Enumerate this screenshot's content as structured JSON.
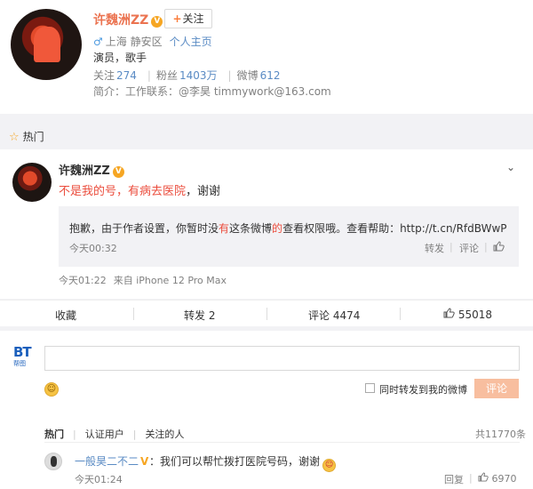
{
  "profile": {
    "name": "许魏洲ZZ",
    "verified_badge": "V",
    "follow_plus": "+",
    "follow_label": "关注",
    "location": "上海 静安区",
    "homepage_link": "个人主页",
    "intro": "演员，歌手",
    "stats": {
      "following_label": "关注",
      "following": "274",
      "fans_label": "粉丝",
      "fans": "1403万",
      "weibo_label": "微博",
      "weibo": "612"
    },
    "description": "简介：工作联系：@李昊 timmywork@163.com"
  },
  "hot_label": "热门",
  "post": {
    "author": "许魏洲ZZ",
    "text_red": "不是我的号，有病去医院",
    "text_plain": "，谢谢",
    "quote": {
      "text_a": "抱歉，由于作者设置，你暂时没",
      "text_red1": "有",
      "text_b": "这条微博",
      "text_red2": "的",
      "text_c": "查看权限哦。查看帮助：http://t.cn/RfdBWwP",
      "time": "今天00:32",
      "repost": "转发",
      "comment": "评论"
    },
    "time": "今天01:22",
    "source": "来自 iPhone 12 Pro Max"
  },
  "actions": {
    "collect": "收藏",
    "repost": "转发 2",
    "comment": "评论 4474",
    "like": "55018"
  },
  "comment_box": {
    "avatar_text_top": "BT",
    "avatar_text_bottom": "帮图",
    "emoji": "☺",
    "repost_label": "同时转发到我的微博",
    "submit_label": "评论"
  },
  "comments": {
    "tabs": [
      "热门",
      "认证用户",
      "关注的人"
    ],
    "total": "共11770条",
    "items": [
      {
        "user": "一般昊二不二",
        "badge": "V",
        "text": "：我们可以帮忙拨打医院号码，谢谢",
        "time": "今天01:24",
        "reply": "回复",
        "likes": "6970"
      }
    ]
  }
}
